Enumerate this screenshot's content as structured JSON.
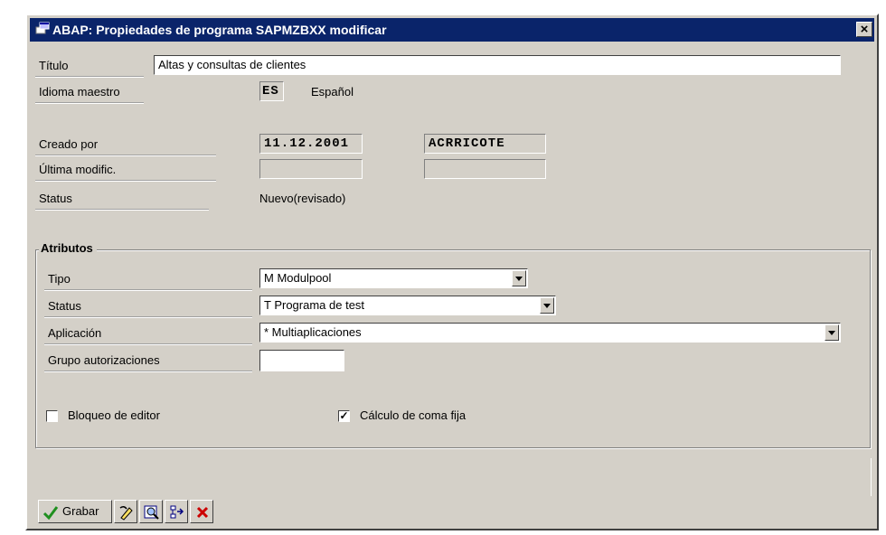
{
  "window": {
    "title": "ABAP: Propiedades de programa SAPMZBXX modificar",
    "close_glyph": "×"
  },
  "fields": {
    "titulo": {
      "label": "Título",
      "value": "Altas y consultas de clientes"
    },
    "idioma": {
      "label": "Idioma maestro",
      "code": "ES",
      "name": "Español"
    },
    "creado": {
      "label": "Creado por",
      "date": "11.12.2001",
      "user": "ACRRICOTE"
    },
    "modific": {
      "label": "Última modific.",
      "date": "",
      "user": ""
    },
    "status": {
      "label": "Status",
      "value": "Nuevo(revisado)"
    }
  },
  "atributos": {
    "title": "Atributos",
    "tipo": {
      "label": "Tipo",
      "value": "M Modulpool"
    },
    "status": {
      "label": "Status",
      "value": "T Programa de test"
    },
    "aplicacion": {
      "label": "Aplicación",
      "value": "* Multiaplicaciones"
    },
    "grupo": {
      "label": "Grupo autorizaciones",
      "value": ""
    },
    "bloqueo": {
      "label": "Bloqueo de editor",
      "checked": false
    },
    "calculo": {
      "label": "Cálculo de coma fija",
      "checked": true,
      "check_glyph": "✓"
    }
  },
  "toolbar": {
    "save_label": "Grabar",
    "icons": [
      "checkmark-icon",
      "pencil-eraser-icon",
      "magnifier-icon",
      "hierarchy-icon",
      "cancel-x-icon"
    ]
  },
  "colors": {
    "titlebar": "#0a246a",
    "window_bg": "#d4d0c8",
    "save_check": "#1f8f1f",
    "cancel": "#cc0000"
  }
}
